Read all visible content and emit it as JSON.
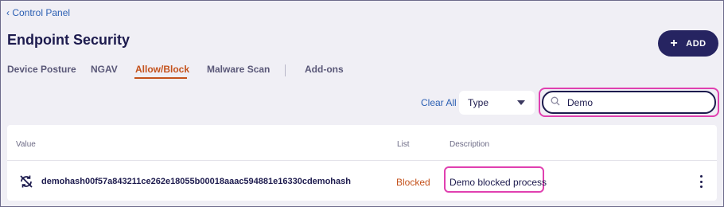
{
  "breadcrumb": {
    "back_label": "‹ Control Panel"
  },
  "header": {
    "title": "Endpoint Security",
    "add_label": "ADD",
    "add_icon": "plus-icon"
  },
  "tabs": [
    {
      "label": "Device Posture",
      "active": false
    },
    {
      "label": "NGAV",
      "active": false
    },
    {
      "label": "Allow/Block",
      "active": true
    },
    {
      "label": "Malware Scan",
      "active": false
    },
    {
      "label": "Add-ons",
      "active": false
    }
  ],
  "filters": {
    "clear_label": "Clear All",
    "type_value": "Type",
    "search_value": "Demo"
  },
  "table": {
    "columns": [
      "Value",
      "List",
      "Description"
    ],
    "rows": [
      {
        "icon": "hash-block-icon",
        "value": "demohash00f57a843211ce262e18055b00018aaac594881e16330cdemohash",
        "list": "Blocked",
        "description": "Demo blocked process"
      }
    ]
  },
  "colors": {
    "accent": "#262461",
    "active_tab": "#c4521c",
    "link": "#2b5fb3",
    "highlight": "#e040b0",
    "blocked": "#c4521c"
  }
}
